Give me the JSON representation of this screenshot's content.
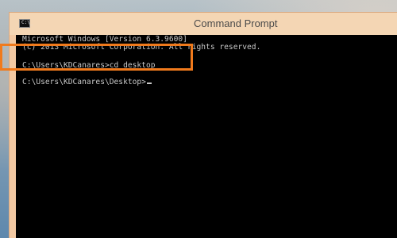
{
  "window": {
    "title": "Command Prompt",
    "icon": "command-prompt-icon",
    "icon_glyph": "C:\\_"
  },
  "console": {
    "lines": [
      "Microsoft Windows [Version 6.3.9600]",
      "(c) 2013 Microsoft Corporation. All rights reserved.",
      "C:\\Users\\KDCanares>cd desktop",
      "C:\\Users\\KDCanares\\Desktop>"
    ],
    "background": "#000000",
    "text_color": "#c8c8c8"
  },
  "annotation": {
    "highlight_color": "#f07a1c"
  }
}
